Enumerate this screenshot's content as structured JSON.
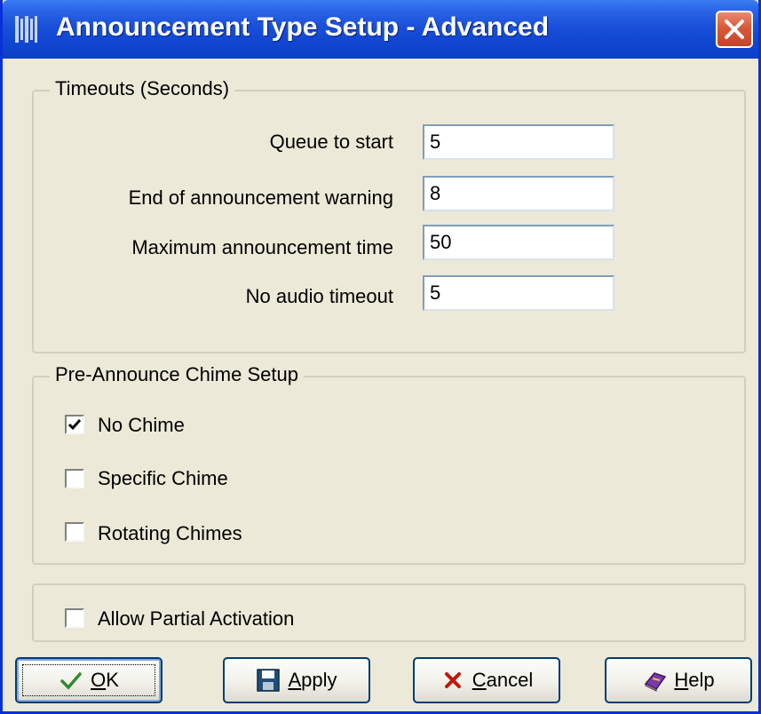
{
  "window": {
    "title": "Announcement Type Setup - Advanced"
  },
  "timeouts": {
    "legend": "Timeouts (Seconds)",
    "fields": [
      {
        "label": "Queue to start",
        "value": "5"
      },
      {
        "label": "End of announcement warning",
        "value": "8"
      },
      {
        "label": "Maximum announcement time",
        "value": "50"
      },
      {
        "label": "No audio timeout",
        "value": "5"
      }
    ]
  },
  "chime": {
    "legend": "Pre-Announce Chime Setup",
    "options": [
      {
        "label": "No Chime",
        "checked": true
      },
      {
        "label": "Specific Chime",
        "checked": false
      },
      {
        "label": "Rotating Chimes",
        "checked": false
      }
    ]
  },
  "activation": {
    "label": "Allow Partial Activation",
    "checked": false
  },
  "buttons": {
    "ok": {
      "mnemonic": "O",
      "rest": "K",
      "icon": "checkmark-icon"
    },
    "apply": {
      "mnemonic": "A",
      "rest": "pply",
      "icon": "floppy-disk-icon"
    },
    "cancel": {
      "mnemonic": "C",
      "rest": "ancel",
      "icon": "x-icon"
    },
    "help": {
      "mnemonic": "H",
      "rest": "elp",
      "icon": "help-book-icon"
    }
  },
  "colors": {
    "titlebar": "#1047d2",
    "dialog_bg": "#ece9d8",
    "close_button": "#d75a3a",
    "button_border": "#003c74"
  }
}
